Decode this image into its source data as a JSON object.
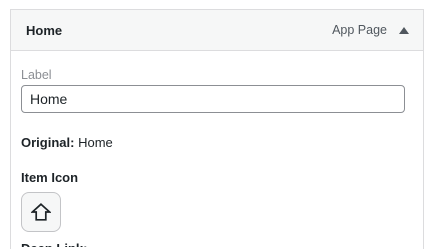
{
  "header": {
    "title": "Home",
    "item_type": "App Page",
    "toggle_icon": "arrow-up-icon"
  },
  "label_field": {
    "label": "Label",
    "value": "Home"
  },
  "original": {
    "label": "Original:",
    "value": "Home"
  },
  "item_icon": {
    "label": "Item Icon",
    "icon": "home-icon"
  },
  "deep_link": {
    "label": "Deep Link:"
  }
}
